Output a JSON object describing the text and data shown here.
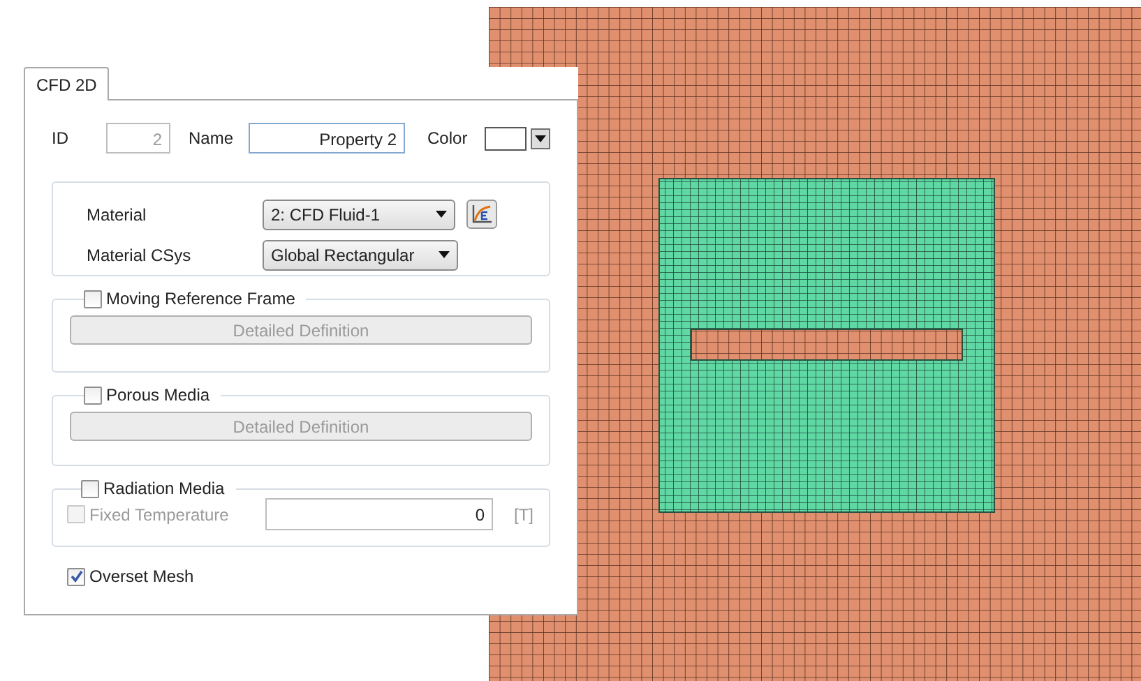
{
  "tabs": [
    {
      "label": "CFD 2D",
      "selected": true
    }
  ],
  "id_field": {
    "label": "ID",
    "value": "2",
    "disabled": true
  },
  "name_field": {
    "label": "Name",
    "value": "Property 2"
  },
  "color_field": {
    "label": "Color",
    "color": "#ffffff"
  },
  "material": {
    "label": "Material",
    "value": "2: CFD Fluid-1"
  },
  "material_csys": {
    "label": "Material CSys",
    "value": "Global Rectangular"
  },
  "groups": [
    {
      "kind": "button",
      "label": "Moving Reference Frame",
      "checked": false,
      "button": "Detailed Definition",
      "disabled": true
    },
    {
      "kind": "button",
      "label": "Porous Media",
      "checked": false,
      "button": "Detailed Definition",
      "disabled": true
    },
    {
      "kind": "temperature",
      "label": "Radiation Media",
      "checked": false,
      "option": {
        "label": "Fixed Temperature",
        "checked": false,
        "disabled": true,
        "value": "0",
        "unit": "[T]"
      }
    }
  ],
  "overset_mesh": {
    "label": "Overset Mesh",
    "checked": true
  }
}
